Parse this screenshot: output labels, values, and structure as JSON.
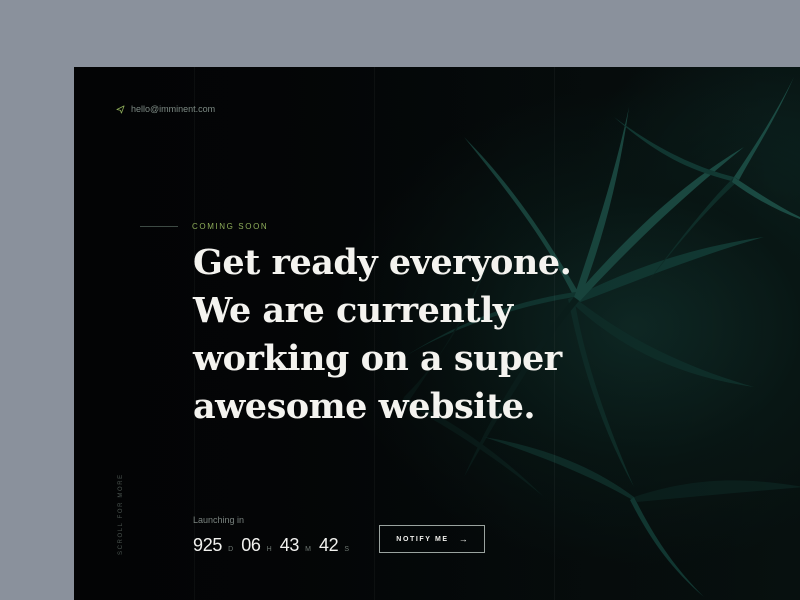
{
  "contact": {
    "email": "hello@imminent.com",
    "icon": "send-icon"
  },
  "hero": {
    "kicker": "COMING SOON",
    "headline_lines": [
      "Get ready everyone.",
      "We are currently",
      "working on a super",
      "awesome website."
    ]
  },
  "scroll_hint": "SCROLL FOR MORE",
  "launch": {
    "label": "Launching in",
    "days": "925",
    "days_unit": "D",
    "hours": "06",
    "hours_unit": "H",
    "minutes": "43",
    "minutes_unit": "M",
    "seconds": "42",
    "seconds_unit": "S"
  },
  "notify_button": {
    "label": "NOTIFY ME",
    "arrow": "→",
    "arrow_icon": "arrow-right-icon"
  },
  "colors": {
    "accent": "#8fae5a",
    "page_background": "#8a919c",
    "frame_background": "#050607",
    "text_primary": "#f4f3ef"
  }
}
